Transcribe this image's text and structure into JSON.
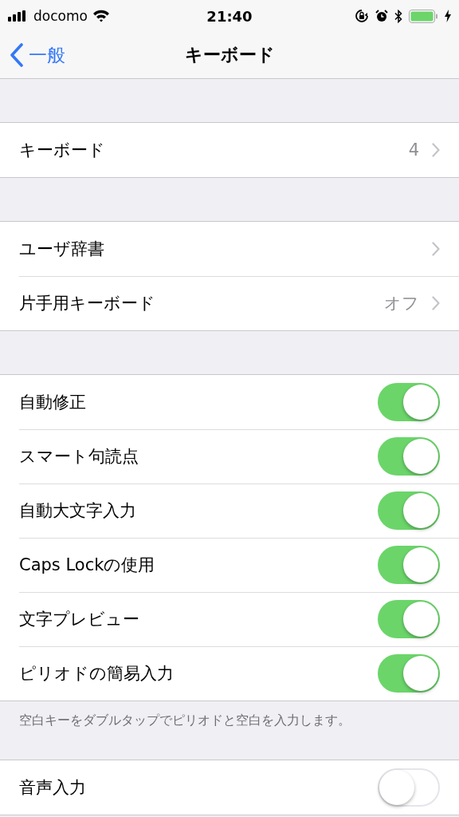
{
  "status_bar": {
    "carrier": "docomo",
    "time": "21:40"
  },
  "nav": {
    "back": "一般",
    "title": "キーボード"
  },
  "sections": [
    {
      "rows": [
        {
          "kind": "link",
          "label": "キーボード",
          "value": "4"
        }
      ]
    },
    {
      "rows": [
        {
          "kind": "link",
          "label": "ユーザ辞書"
        },
        {
          "kind": "link",
          "label": "片手用キーボード",
          "value": "オフ"
        }
      ]
    },
    {
      "rows": [
        {
          "kind": "toggle",
          "label": "自動修正",
          "on": true
        },
        {
          "kind": "toggle",
          "label": "スマート句読点",
          "on": true
        },
        {
          "kind": "toggle",
          "label": "自動大文字入力",
          "on": true
        },
        {
          "kind": "toggle",
          "label": "Caps Lockの使用",
          "on": true
        },
        {
          "kind": "toggle",
          "label": "文字プレビュー",
          "on": true
        },
        {
          "kind": "toggle",
          "label": "ピリオドの簡易入力",
          "on": true
        }
      ],
      "footer": "空白キーをダブルタップでピリオドと空白を入力します。"
    },
    {
      "rows": [
        {
          "kind": "toggle",
          "label": "音声入力",
          "on": false
        }
      ]
    }
  ]
}
